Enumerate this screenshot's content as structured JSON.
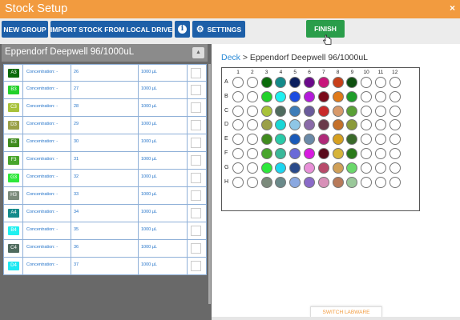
{
  "app": {
    "title": "Stock Setup",
    "close_label": "×"
  },
  "toolbar": {
    "new_group": "NEW GROUP",
    "import": "IMPORT STOCK FROM LOCAL DRIVE",
    "info": "i",
    "settings": "SETTINGS",
    "finish": "FINISH"
  },
  "left_panel": {
    "header": "Eppendorf Deepwell 96/1000uL",
    "rows": [
      {
        "well": "A3",
        "color": "#0b6b0b",
        "concentration": "Concentration: -",
        "number": "26",
        "volume": "1000 µL"
      },
      {
        "well": "B3",
        "color": "#22d12a",
        "concentration": "Concentration: -",
        "number": "27",
        "volume": "1000 µL"
      },
      {
        "well": "C3",
        "color": "#a8c23a",
        "concentration": "Concentration: -",
        "number": "28",
        "volume": "1000 µL"
      },
      {
        "well": "D3",
        "color": "#9aa048",
        "concentration": "Concentration: -",
        "number": "29",
        "volume": "1000 µL"
      },
      {
        "well": "E3",
        "color": "#3f8b1e",
        "concentration": "Concentration: -",
        "number": "30",
        "volume": "1000 µL"
      },
      {
        "well": "F3",
        "color": "#48a52c",
        "concentration": "Concentration: -",
        "number": "31",
        "volume": "1000 µL"
      },
      {
        "well": "G3",
        "color": "#2ee83b",
        "concentration": "Concentration: -",
        "number": "32",
        "volume": "1000 µL"
      },
      {
        "well": "H3",
        "color": "#7b8a7b",
        "concentration": "Concentration: -",
        "number": "33",
        "volume": "1000 µL"
      },
      {
        "well": "A4",
        "color": "#148a8a",
        "concentration": "Concentration: -",
        "number": "34",
        "volume": "1000 µL"
      },
      {
        "well": "B4",
        "color": "#1ff0f0",
        "concentration": "Concentration: -",
        "number": "35",
        "volume": "1000 µL"
      },
      {
        "well": "C4",
        "color": "#4f6b5e",
        "concentration": "Concentration: -",
        "number": "36",
        "volume": "1000 µL"
      },
      {
        "well": "D4",
        "color": "#1ee8f2",
        "concentration": "Concentration: -",
        "number": "37",
        "volume": "1000 µL"
      }
    ]
  },
  "breadcrumb": {
    "link": "Deck",
    "separator": " > ",
    "current": "Eppendorf Deepwell 96/1000uL"
  },
  "plate": {
    "columns": [
      "1",
      "2",
      "3",
      "4",
      "5",
      "6",
      "7",
      "8",
      "9",
      "10",
      "11",
      "12"
    ],
    "rows": [
      "A",
      "B",
      "C",
      "D",
      "E",
      "F",
      "G",
      "H"
    ],
    "wells": [
      [
        "#ffffff",
        "#ffffff",
        "#0b6b0b",
        "#148a8a",
        "#0b1f5e",
        "#6a0a8a",
        "#c8157a",
        "#c8401a",
        "#0f5010",
        "#ffffff",
        "#ffffff",
        "#ffffff"
      ],
      [
        "#ffffff",
        "#ffffff",
        "#22d12a",
        "#1ff0f0",
        "#1b4ce0",
        "#b41adb",
        "#7a0a1a",
        "#e07a1a",
        "#1f9d2a",
        "#ffffff",
        "#ffffff",
        "#ffffff"
      ],
      [
        "#ffffff",
        "#ffffff",
        "#a8c23a",
        "#4f6b5e",
        "#3e7db8",
        "#6a5b9b",
        "#c82a2a",
        "#d89a6b",
        "#5aa036",
        "#ffffff",
        "#ffffff",
        "#ffffff"
      ],
      [
        "#ffffff",
        "#ffffff",
        "#9aa048",
        "#1ad6d6",
        "#8ec6e6",
        "#8a6aa8",
        "#6a3a4a",
        "#c4702a",
        "#8a9a3a",
        "#ffffff",
        "#ffffff",
        "#ffffff"
      ],
      [
        "#ffffff",
        "#ffffff",
        "#3f8b1e",
        "#2acaa8",
        "#1a5ab8",
        "#6a8aa8",
        "#b02a7a",
        "#d6a020",
        "#3a6a2a",
        "#ffffff",
        "#ffffff",
        "#ffffff"
      ],
      [
        "#ffffff",
        "#ffffff",
        "#48a52c",
        "#3ab89a",
        "#6a6ad8",
        "#d81ae0",
        "#5a0a1a",
        "#d6b43a",
        "#2a7a1a",
        "#ffffff",
        "#ffffff",
        "#ffffff"
      ],
      [
        "#ffffff",
        "#ffffff",
        "#2ee83b",
        "#1ed6f0",
        "#2a4a8a",
        "#e890d8",
        "#b84a6a",
        "#d0a058",
        "#6ad86a",
        "#ffffff",
        "#ffffff",
        "#ffffff"
      ],
      [
        "#ffffff",
        "#ffffff",
        "#7b8a7b",
        "#6a8a8a",
        "#8aa8e0",
        "#8a6ac8",
        "#d890b8",
        "#b87a5a",
        "#9ac89a",
        "#ffffff",
        "#ffffff",
        "#ffffff"
      ]
    ]
  },
  "footer": {
    "switch_labware": "SWITCH LABWARE"
  },
  "colors": {
    "accent": "#f29b3f",
    "primary": "#1d5fa8",
    "finish": "#2a9d4a",
    "link": "#2a8ad6"
  }
}
